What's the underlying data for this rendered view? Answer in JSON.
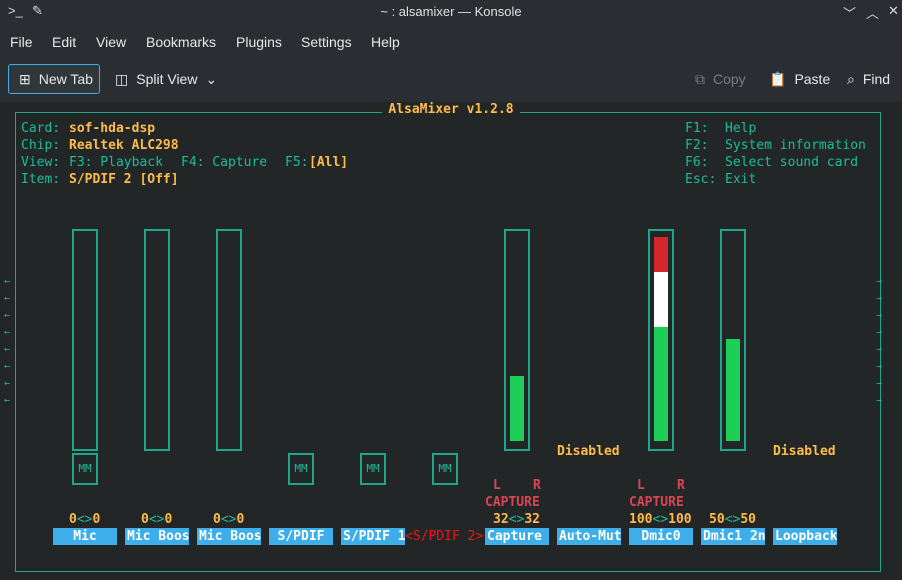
{
  "window": {
    "title": "~ : alsamixer — Konsole"
  },
  "menu": [
    "File",
    "Edit",
    "View",
    "Bookmarks",
    "Plugins",
    "Settings",
    "Help"
  ],
  "toolbar": {
    "new_tab": "New Tab",
    "split_view": "Split View",
    "copy": "Copy",
    "paste": "Paste",
    "find": "Find"
  },
  "mixer": {
    "title": "AlsaMixer v1.2.8",
    "card_label": "Card:",
    "card_value": "sof-hda-dsp",
    "chip_label": "Chip:",
    "chip_value": "Realtek ALC298",
    "view_label": "View:",
    "view_f3": "F3: Playback",
    "view_f4": "F4: Capture",
    "view_f5": "F5:",
    "view_all": "[All]",
    "item_label": "Item:",
    "item_value": "S/PDIF 2 [Off]",
    "help": [
      {
        "key": "F1:",
        "text": "Help"
      },
      {
        "key": "F2:",
        "text": "System information"
      },
      {
        "key": "F6:",
        "text": "Select sound card"
      },
      {
        "key": "Esc:",
        "text": "Exit"
      }
    ],
    "left_arrow": "←",
    "right_arrow": "→",
    "mm": "MM",
    "disabled": "Disabled",
    "capture": "CAPTURE",
    "l": "L",
    "r": "R",
    "values": {
      "mic": [
        "0",
        "<>",
        "0"
      ],
      "micboost1": [
        "0",
        "<>",
        "0"
      ],
      "micboost2": [
        "0",
        "<>",
        "0"
      ],
      "capture": [
        "32",
        "<>",
        "32"
      ],
      "dmic0": [
        "100",
        "<>",
        "100"
      ],
      "dmic1": [
        "50",
        "<>",
        "50"
      ]
    },
    "channels": [
      "Mic",
      "Mic Boos",
      "Mic Boos",
      "S/PDIF",
      "S/PDIF 1",
      "S/PDIF 2",
      "Capture",
      "Auto-Mut",
      "Dmic0",
      "Dmic1 2n",
      "Loopback"
    ],
    "levels": {
      "capture": 0.32,
      "dmic0": 1.0,
      "dmic1": 0.5
    },
    "colors": {
      "frame": "#1fa58b",
      "green": "#1dce57",
      "white": "#ffffff",
      "red": "#d4262c",
      "label_bg": "#3daee9"
    }
  }
}
